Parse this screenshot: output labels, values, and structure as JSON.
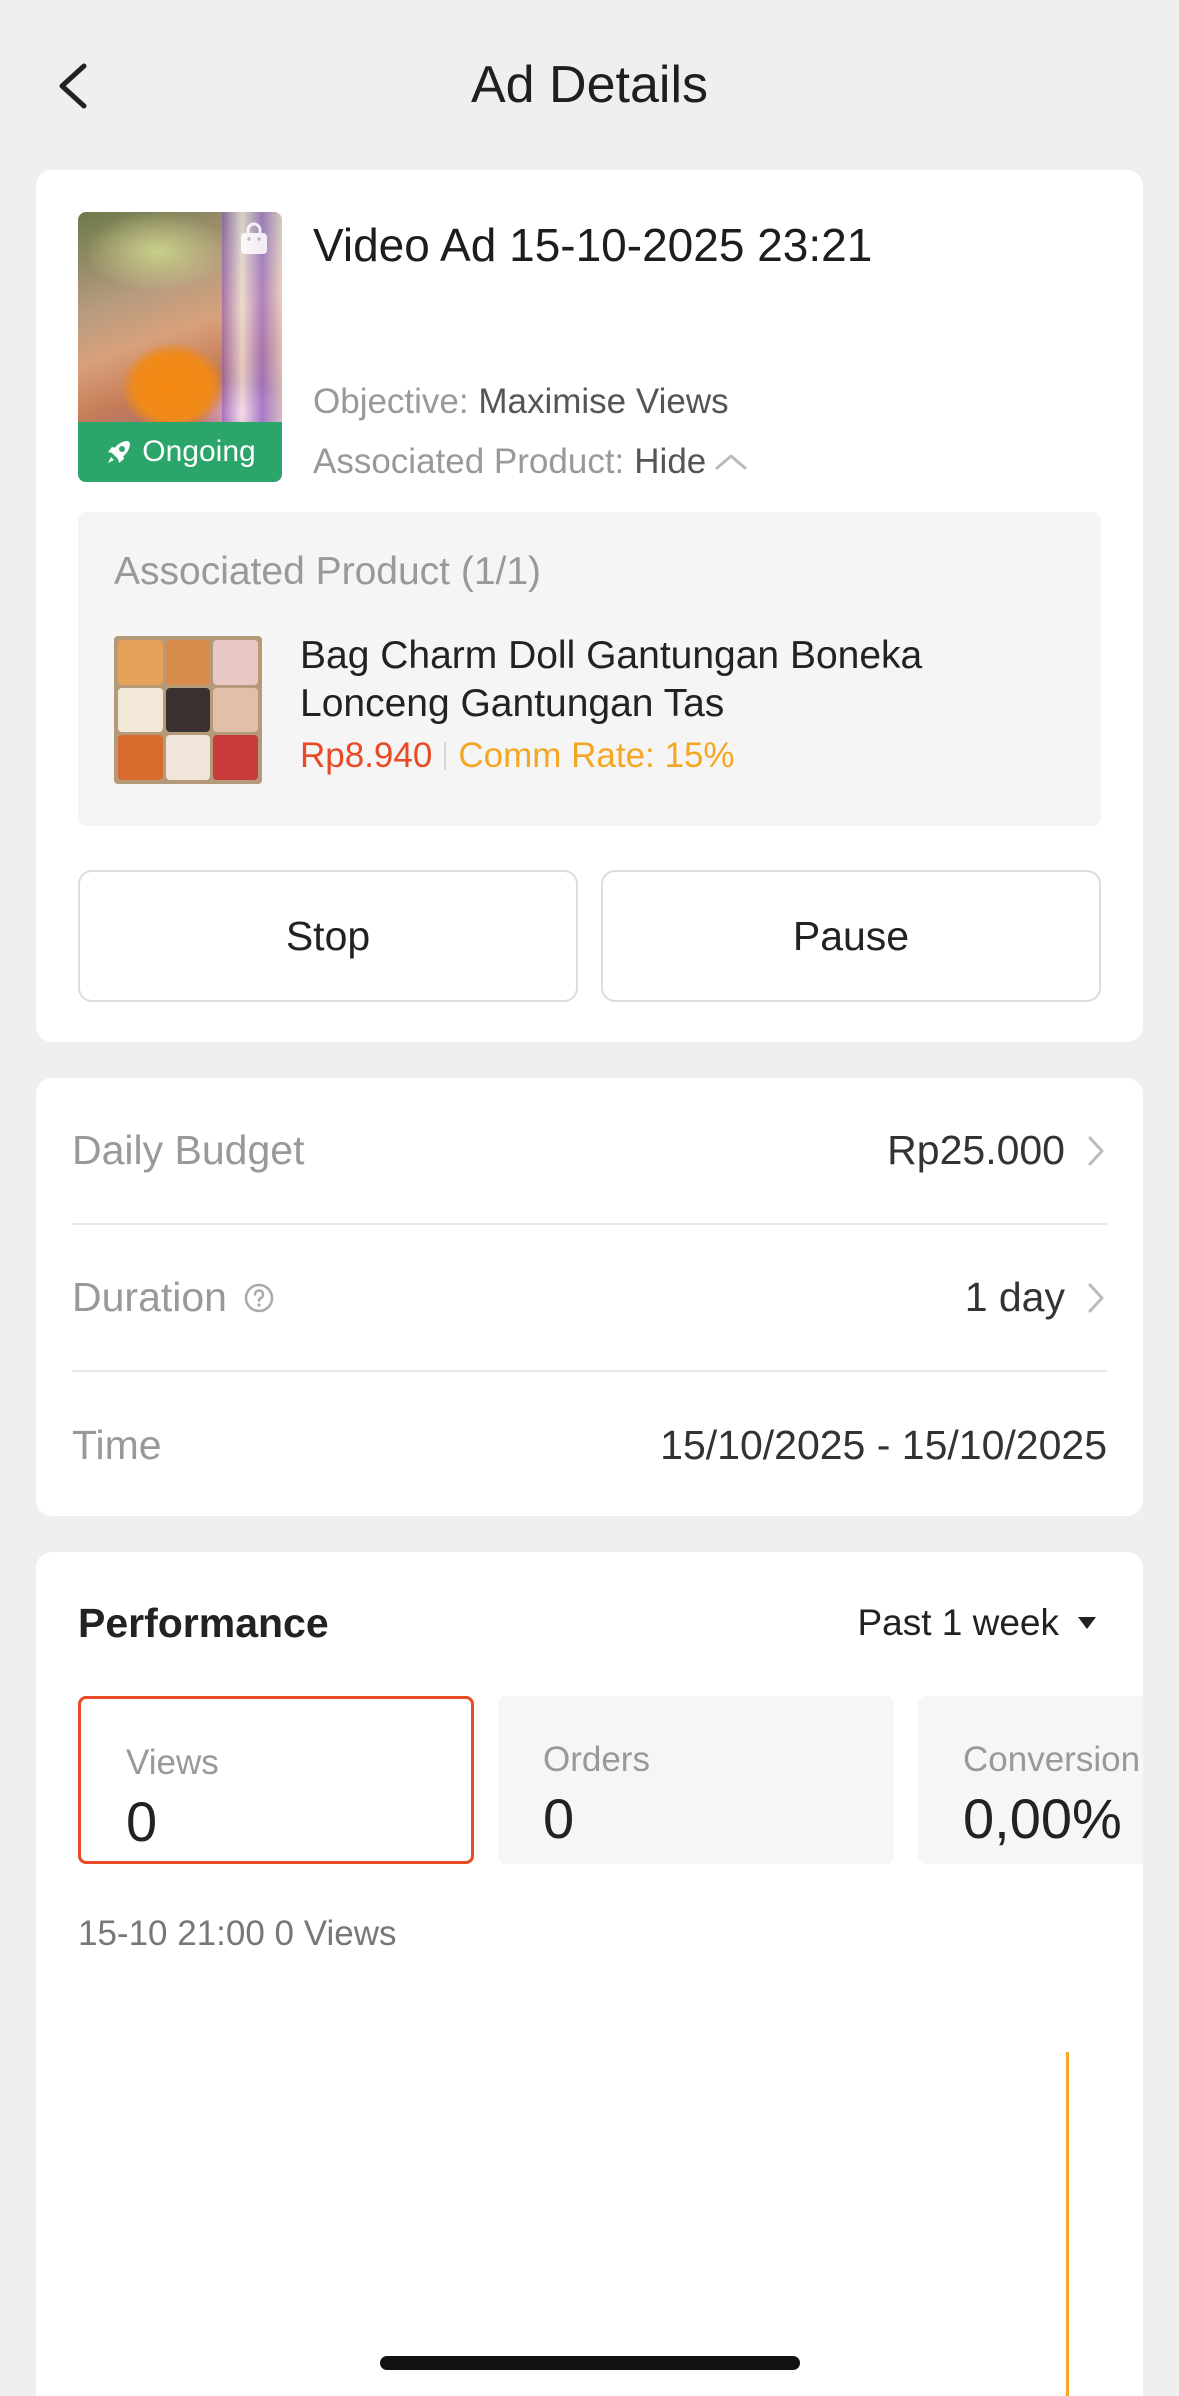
{
  "header": {
    "title": "Ad Details"
  },
  "ad": {
    "title": "Video Ad 15-10-2025 23:21",
    "status": "Ongoing",
    "objective_label": "Objective:",
    "objective_value": "Maximise Views",
    "assoc_label": "Associated Product:",
    "assoc_toggle": "Hide"
  },
  "associated_products": {
    "title": "Associated Product (1/1)",
    "items": [
      {
        "name": "Bag Charm Doll Gantungan Boneka Lonceng Gantungan Tas",
        "price": "Rp8.940",
        "comm_rate": "Comm Rate: 15%"
      }
    ]
  },
  "actions": {
    "stop": "Stop",
    "pause": "Pause"
  },
  "budget": {
    "daily_budget_label": "Daily Budget",
    "daily_budget_value": "Rp25.000",
    "duration_label": "Duration",
    "duration_value": "1 day",
    "time_label": "Time",
    "time_value": "15/10/2025 - 15/10/2025"
  },
  "performance": {
    "title": "Performance",
    "period": "Past 1 week",
    "metrics": [
      {
        "label": "Views",
        "value": "0"
      },
      {
        "label": "Orders",
        "value": "0"
      },
      {
        "label": "Conversion",
        "value": "0,00%"
      }
    ],
    "chart_info": "15-10 21:00 0 Views"
  },
  "colors": {
    "accent": "#e84a25",
    "status_green": "#2ba56a",
    "comm_orange": "#f5a623"
  }
}
